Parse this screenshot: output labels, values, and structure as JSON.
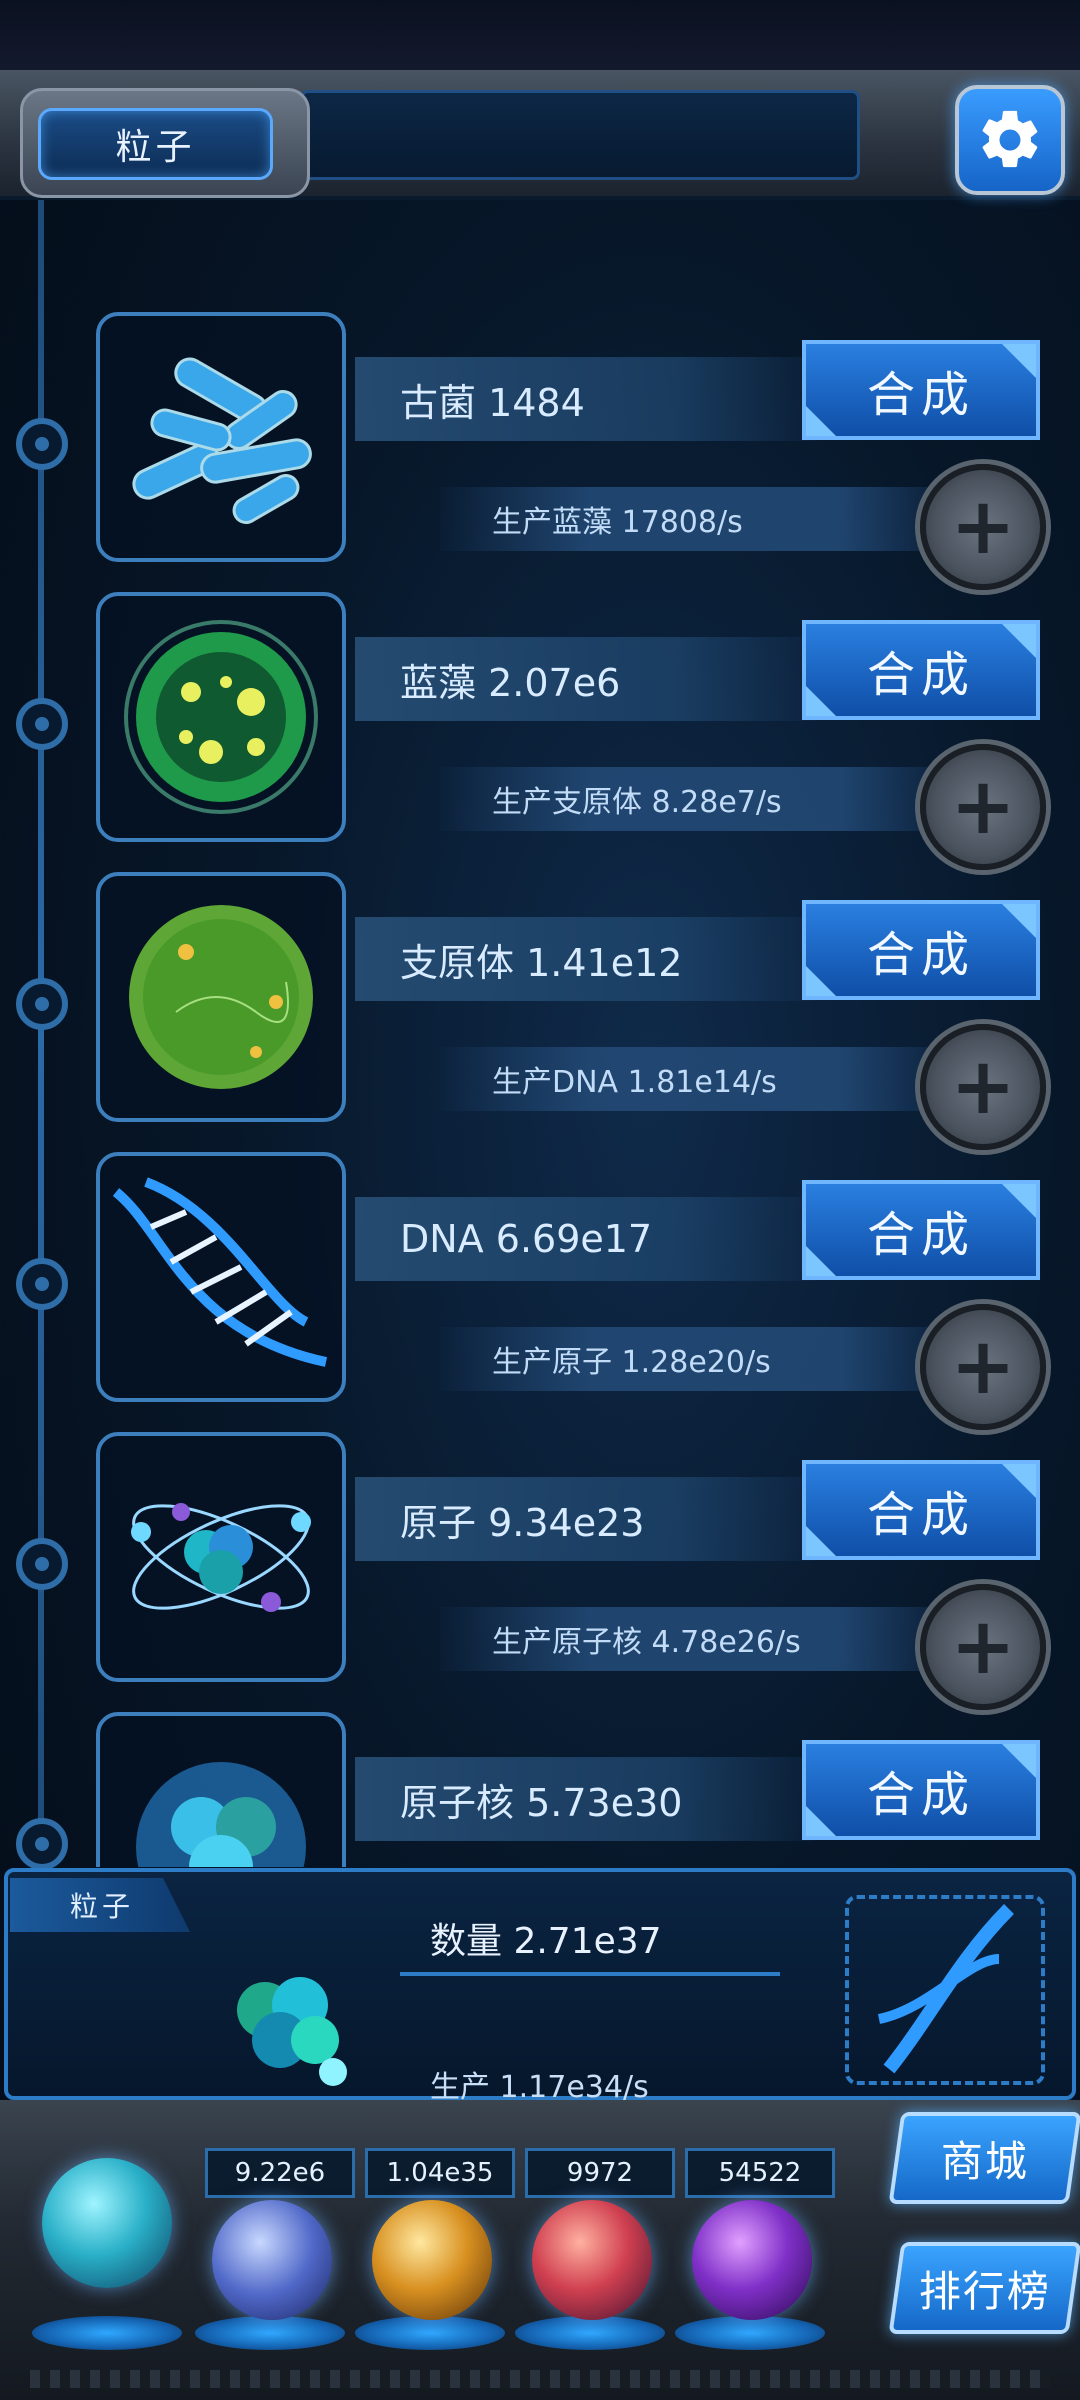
{
  "header": {
    "title": "粒子",
    "settings_icon": "gear-icon"
  },
  "items": [
    {
      "name": "古菌 1484",
      "production": "生产蓝藻 17808/s",
      "synth_label": "合成",
      "icon": "bacteria-icon"
    },
    {
      "name": "蓝藻 2.07e6",
      "production": "生产支原体 8.28e7/s",
      "synth_label": "合成",
      "icon": "cyanobacteria-icon"
    },
    {
      "name": "支原体 1.41e12",
      "production": "生产DNA 1.81e14/s",
      "synth_label": "合成",
      "icon": "mycoplasma-icon"
    },
    {
      "name": "DNA 6.69e17",
      "production": "生产原子 1.28e20/s",
      "synth_label": "合成",
      "icon": "dna-icon"
    },
    {
      "name": "原子 9.34e23",
      "production": "生产原子核 4.78e26/s",
      "synth_label": "合成",
      "icon": "atom-icon"
    },
    {
      "name": "原子核 5.73e30",
      "production": "",
      "synth_label": "合成",
      "icon": "nucleus-icon"
    }
  ],
  "info_panel": {
    "tag": "粒子",
    "quantity": "数量 2.71e37",
    "production": "生产 1.17e34/s",
    "icon": "particle-cluster-icon",
    "dna_icon": "dna-helix-icon"
  },
  "resources": [
    {
      "value": "9.22e6",
      "icon": "lightning-orb-icon"
    },
    {
      "value": "1.04e35",
      "icon": "fire-orb-icon"
    },
    {
      "value": "9972",
      "icon": "brain-orb-icon"
    },
    {
      "value": "54522",
      "icon": "vortex-orb-icon"
    }
  ],
  "buttons": {
    "shop": "商城",
    "leaderboard": "排行榜"
  },
  "colors": {
    "accent": "#2a7fe0",
    "panel_border": "#2d7cc8",
    "background": "#071729"
  }
}
